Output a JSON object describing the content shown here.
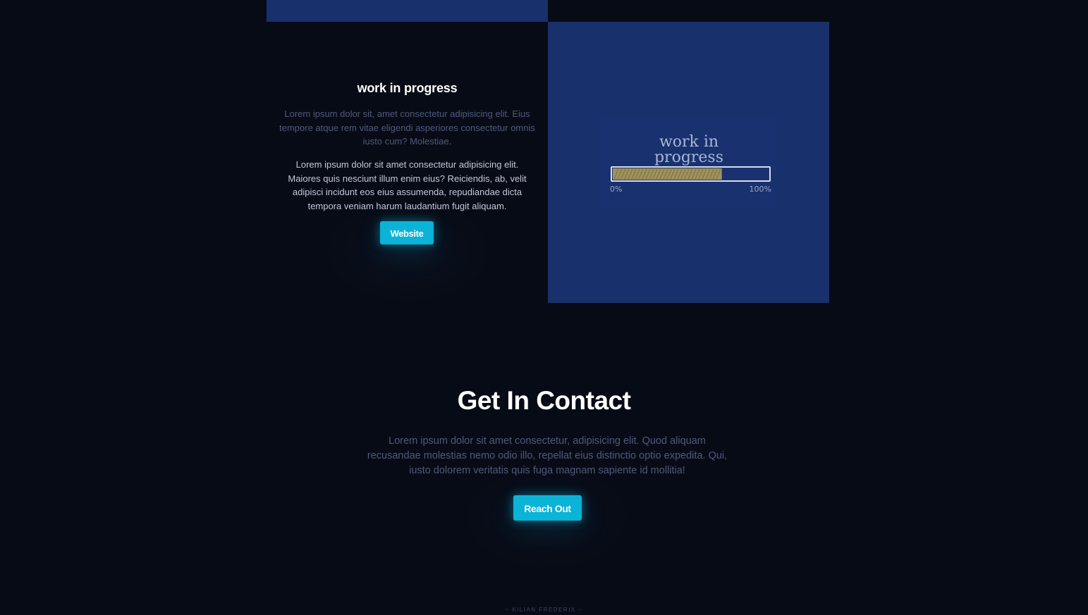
{
  "project": {
    "title": "work in progress",
    "muted_text": "Lorem ipsum dolor sit, amet consectetur adipisicing elit. Eius tempore atque rem vitae eligendi asperiores consectetur omnis iusto cum? Molestiae.",
    "description": "Lorem ipsum dolor sit amet consectetur adipisicing elit. Maiores quis nesciunt illum enim eius? Reiciendis, ab, velit adipisci incidunt eos eius assumenda, repudiandae dicta tempora veniam harum laudantium fugit aliquam.",
    "button_label": "Website",
    "image": {
      "line1": "work in",
      "line2": "progress",
      "min_label": "0%",
      "max_label": "100%",
      "progress_fraction": 0.7
    }
  },
  "contact": {
    "title": "Get In Contact",
    "text": "Lorem ipsum dolor sit amet consectetur, adipisicing elit. Quod aliquam recusandae molestias nemo odio illo, repellat eius distinctio optio expedita. Qui, iusto dolorem veritatis quis fuga magnam sapiente id mollitia!",
    "button_label": "Reach Out"
  },
  "footer": {
    "text": "~ KILIAN FREDERIX ~"
  },
  "colors": {
    "background": "#070b15",
    "panel": "#18306b",
    "accent": "#0bb3d6",
    "muted_text": "#4f5a7c",
    "body_text": "#c3c8da",
    "progress_fill": "#b9a35a"
  }
}
